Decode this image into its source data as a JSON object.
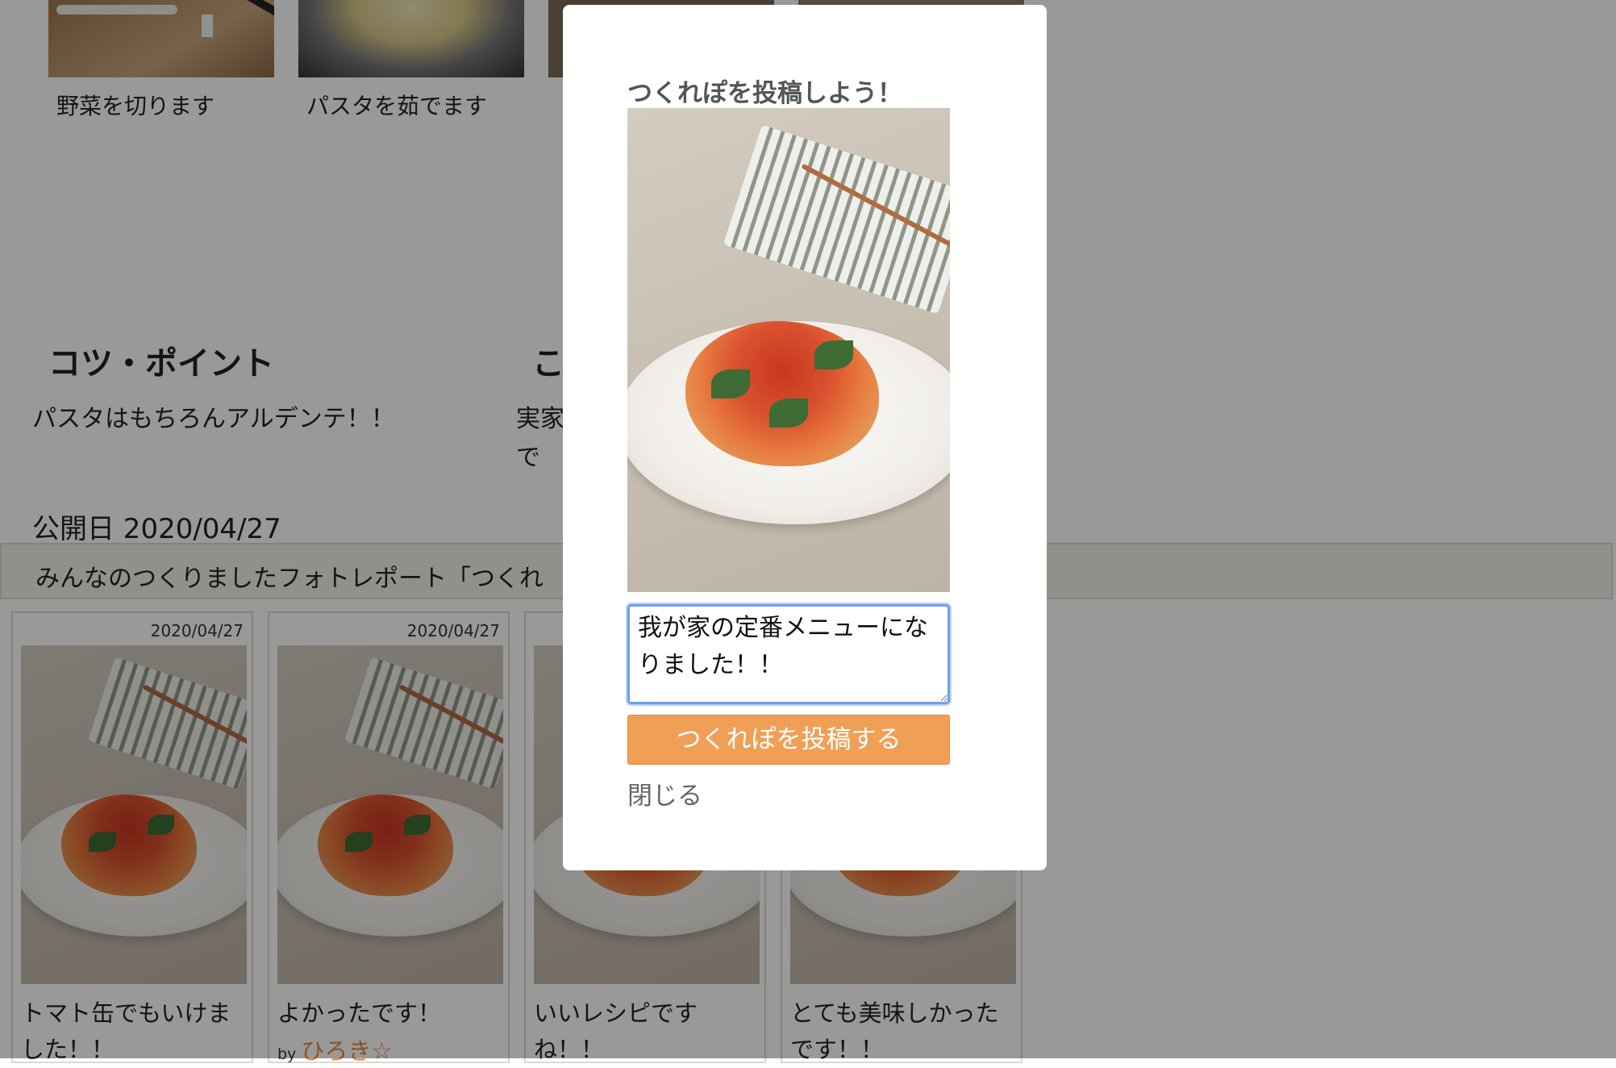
{
  "steps": [
    {
      "caption": "野菜を切ります"
    },
    {
      "caption": "パスタを茹でます"
    }
  ],
  "tips": {
    "heading": "コツ・ポイント",
    "text": "パスタはもちろんアルデンテ！！"
  },
  "story": {
    "heading": "こ",
    "line1": "実家",
    "line2": "で"
  },
  "publish": {
    "label": "公開日 2020/04/27"
  },
  "reports": {
    "bar_text": "みんなのつくりましたフォトレポート「つくれ",
    "cards": [
      {
        "date": "2020/04/27",
        "comment": "トマト缶でもいけました！！",
        "by_label": "",
        "by_name": ""
      },
      {
        "date": "2020/04/27",
        "comment": "よかったです！",
        "by_label": "by",
        "by_name": "ひろき☆"
      },
      {
        "date": "",
        "comment": "いいレシピですね！！",
        "by_label": "",
        "by_name": ""
      },
      {
        "date": "",
        "comment": "とても美味しかったです！！",
        "by_label": "",
        "by_name": ""
      }
    ]
  },
  "modal": {
    "title": "つくれぽを投稿しよう！",
    "comment_value": "我が家の定番メニューになりました！！",
    "submit_label": "つくれぽを投稿する",
    "close_label": "閉じる"
  },
  "colors": {
    "accent": "#f0a056",
    "link": "#e8883a",
    "focus": "#6e9ee8"
  }
}
